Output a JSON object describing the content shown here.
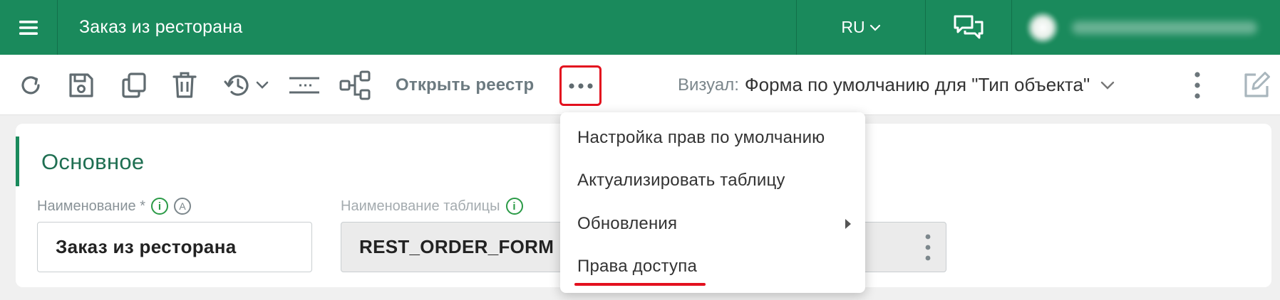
{
  "topbar": {
    "menu_icon": "hamburger-icon",
    "app_title": "Заказ из ресторана",
    "language": "RU",
    "language_icon": "chevron-down-icon",
    "chat_icon": "chat-bubbles-icon",
    "colors": {
      "primary": "#1a8a5c",
      "primary_dark": "#12704a"
    }
  },
  "toolbar": {
    "icons": [
      "refresh-icon",
      "save-icon",
      "copy-icon",
      "delete-icon",
      "history-icon",
      "list-icon",
      "structure-icon",
      "more-icon"
    ],
    "open_registry_label": "Открыть реестр",
    "visual_label": "Визуал:",
    "visual_value": "Форма по умолчанию для \"Тип объекта\"",
    "highlight_color": "#e3101e"
  },
  "section": {
    "title": "Основное"
  },
  "fields": [
    {
      "label": "Наименование *",
      "value": "Заказ из ресторана"
    },
    {
      "label": "Наименование таблицы",
      "value": "REST_ORDER_FORM"
    }
  ],
  "dropdown": {
    "items": [
      {
        "label": "Настройка прав по умолчанию"
      },
      {
        "label": "Актуализировать таблицу"
      },
      {
        "label": "Обновления",
        "submenu": true
      },
      {
        "label": "Права доступа",
        "highlighted": true
      }
    ]
  }
}
